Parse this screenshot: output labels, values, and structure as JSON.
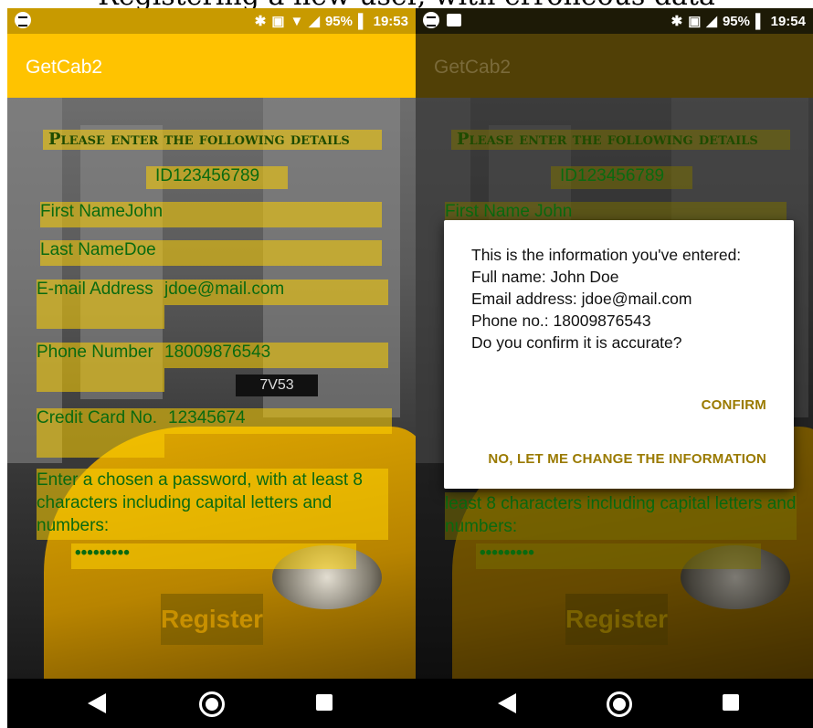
{
  "caption": "Registering a new user, with erroneous data",
  "phone1": {
    "status": {
      "battery": "95%",
      "time": "19:53"
    },
    "app_title": "GetCab2",
    "header": "Please enter the following details",
    "id_field": "ID123456789",
    "first_name_label": "First Name",
    "first_name_value": "John",
    "last_name_label": "Last Name",
    "last_name_value": "Doe",
    "email_label": "E-mail Address",
    "email_value": "jdoe@mail.com",
    "phone_label": "Phone Number",
    "phone_value": "18009876543",
    "cc_label": "Credit Card No.",
    "cc_value": "12345674",
    "password_prompt": "Enter a chosen a password, with at least 8 characters including capital letters and numbers:",
    "password_value": "•••••••••",
    "register_label": "Register",
    "taxi_sign": "7V53"
  },
  "phone2": {
    "status": {
      "battery": "95%",
      "time": "19:54"
    },
    "app_title": "GetCab2",
    "header": "Please enter the following details",
    "id_field": "ID123456789",
    "first_name_partial": "First Name John",
    "password_prompt_partial": "least 8 characters including capital letters and numbers:",
    "password_value": "•••••••••",
    "register_label": "Register",
    "dialog": {
      "line1": "This is the information you've entered:",
      "line2": "Full name: John Doe",
      "line3": "Email address: jdoe@mail.com",
      "line4": "Phone no.: 18009876543",
      "line5": "Do you confirm it is accurate?",
      "confirm_label": "CONFIRM",
      "change_label": "NO, LET ME CHANGE THE INFORMATION"
    }
  },
  "colors": {
    "accent": "#ffc300",
    "field_text": "#0a6a10",
    "dialog_button": "#9a7a00"
  },
  "icons": [
    "spotify-icon",
    "bluetooth-icon",
    "nfc-icon",
    "wifi-icon",
    "signal-icon",
    "battery-icon",
    "image-icon",
    "back-icon",
    "home-icon",
    "recents-icon"
  ]
}
